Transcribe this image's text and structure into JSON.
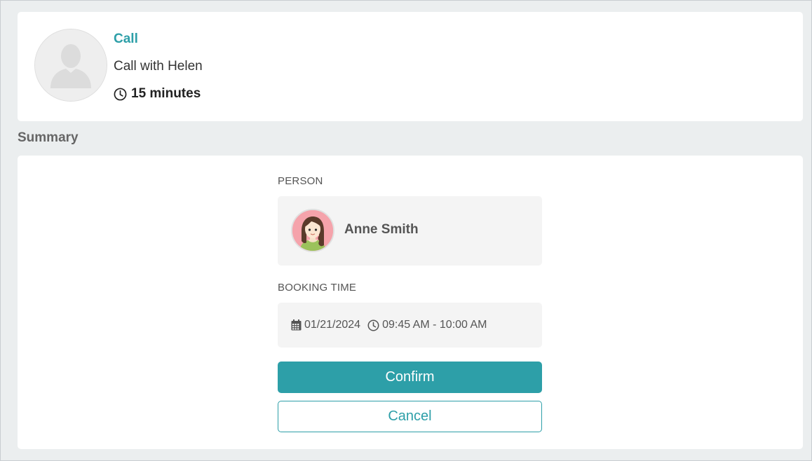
{
  "event": {
    "type": "Call",
    "name": "Call with Helen",
    "duration": "15 minutes"
  },
  "summary": {
    "heading": "Summary",
    "person_label": "PERSON",
    "person_name": "Anne Smith",
    "booking_label": "BOOKING TIME",
    "date": "01/21/2024",
    "time_range": "09:45 AM - 10:00 AM"
  },
  "actions": {
    "confirm_label": "Confirm",
    "cancel_label": "Cancel"
  },
  "colors": {
    "accent": "#2d9fa8",
    "background": "#ebeeef",
    "card": "#ffffff",
    "field": "#f4f4f4"
  },
  "icons": {
    "event_avatar": "user-placeholder-icon",
    "duration": "clock-icon",
    "date": "calendar-icon",
    "time": "clock-icon"
  }
}
